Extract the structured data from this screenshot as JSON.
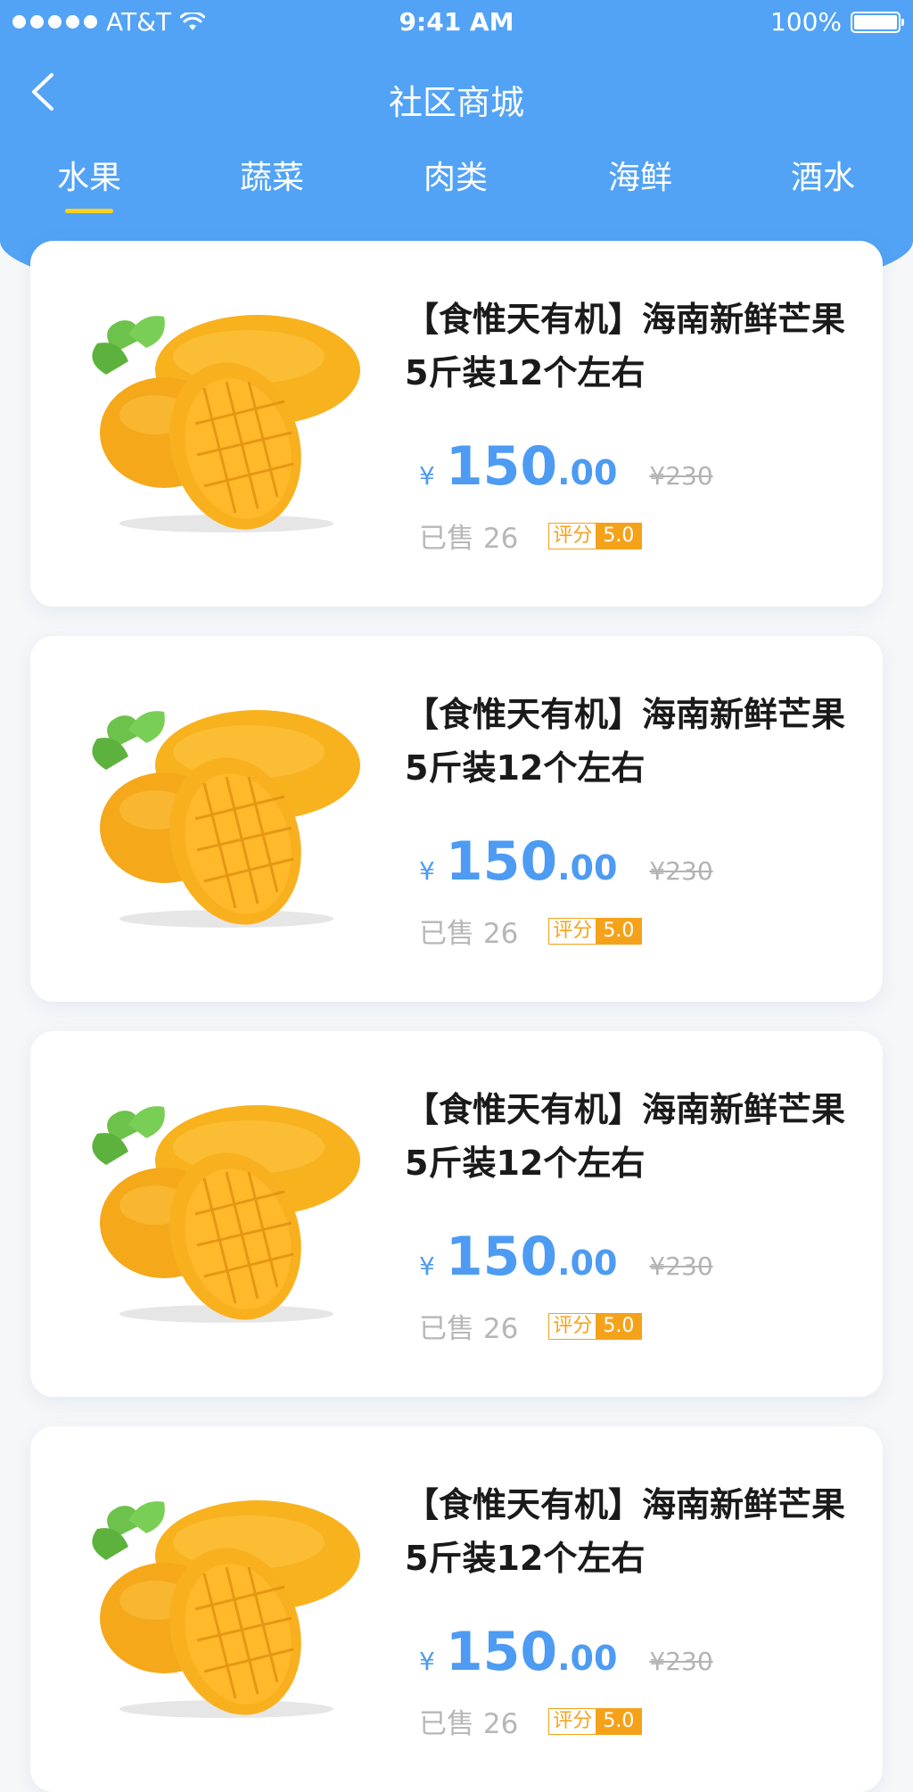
{
  "status_bar": {
    "carrier": "AT&T",
    "time": "9:41 AM",
    "battery": "100%"
  },
  "header": {
    "title": "社区商城"
  },
  "tabs": [
    {
      "label": "水果",
      "active": true
    },
    {
      "label": "蔬菜",
      "active": false
    },
    {
      "label": "肉类",
      "active": false
    },
    {
      "label": "海鲜",
      "active": false
    },
    {
      "label": "酒水",
      "active": false
    }
  ],
  "products": [
    {
      "title": "【食惟天有机】海南新鲜芒果 5斤装12个左右",
      "currency": "¥",
      "price_int": "150",
      "price_dec": ".00",
      "original_price": "¥230",
      "sold": "已售 26",
      "rating_label": "评分",
      "rating": "5.0"
    },
    {
      "title": "【食惟天有机】海南新鲜芒果 5斤装12个左右",
      "currency": "¥",
      "price_int": "150",
      "price_dec": ".00",
      "original_price": "¥230",
      "sold": "已售 26",
      "rating_label": "评分",
      "rating": "5.0"
    },
    {
      "title": "【食惟天有机】海南新鲜芒果 5斤装12个左右",
      "currency": "¥",
      "price_int": "150",
      "price_dec": ".00",
      "original_price": "¥230",
      "sold": "已售 26",
      "rating_label": "评分",
      "rating": "5.0"
    },
    {
      "title": "【食惟天有机】海南新鲜芒果 5斤装12个左右",
      "currency": "¥",
      "price_int": "150",
      "price_dec": ".00",
      "original_price": "¥230",
      "sold": "已售 26",
      "rating_label": "评分",
      "rating": "5.0"
    }
  ],
  "colors": {
    "header_bg": "#52a3f5",
    "accent_price": "#4d9bf2",
    "tab_indicator": "#ffd21f",
    "rating_badge": "#f5a21b"
  },
  "icons": {
    "back": "chevron-left-icon",
    "wifi": "wifi-icon",
    "battery": "battery-icon",
    "signal": "signal-dots-icon",
    "product_image": "mango-image"
  }
}
